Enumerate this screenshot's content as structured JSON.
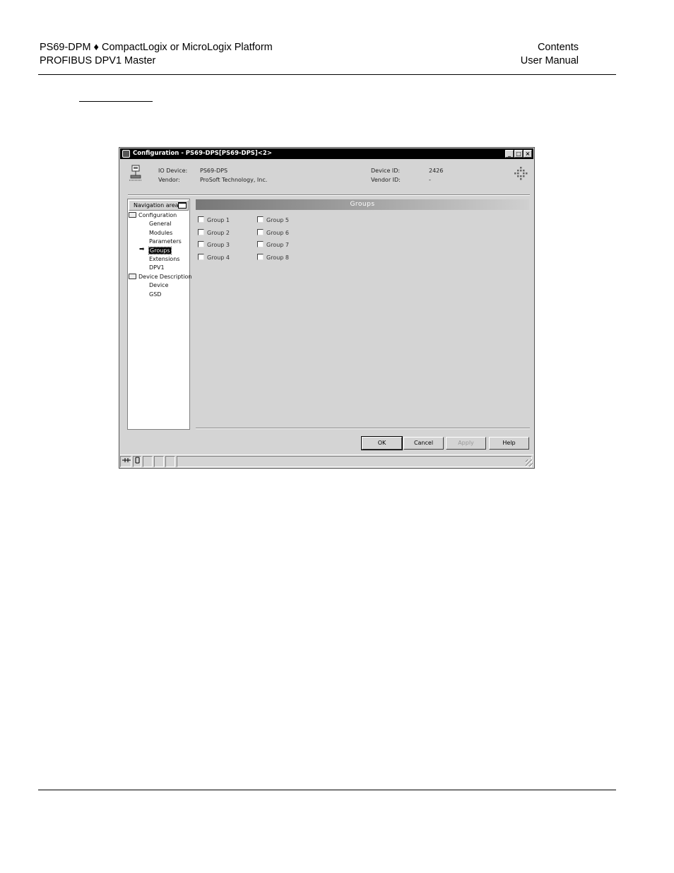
{
  "header": {
    "left_line1": "PS69-DPM ♦ CompactLogix or MicroLogix Platform",
    "left_line2": "PROFIBUS DPV1 Master",
    "right_line1": "Contents",
    "right_line2": "User Manual"
  },
  "dialog": {
    "title": "Configuration - PS69-DPS[PS69-DPS]<2>",
    "window_buttons": [
      "_",
      "□",
      "×"
    ],
    "info": {
      "io_device_label": "IO Device:",
      "io_device_value": "PS69-DPS",
      "vendor_label": "Vendor:",
      "vendor_value": "ProSoft Technology, Inc.",
      "device_id_label": "Device ID:",
      "device_id_value": "2426",
      "vendor_id_label": "Vendor ID:",
      "vendor_id_value": "-"
    },
    "nav": {
      "title": "Navigation area",
      "items": [
        {
          "label": "Configuration",
          "type": "folder"
        },
        {
          "label": "General",
          "type": "leaf"
        },
        {
          "label": "Modules",
          "type": "leaf"
        },
        {
          "label": "Parameters",
          "type": "leaf"
        },
        {
          "label": "Groups",
          "type": "leaf",
          "selected": true
        },
        {
          "label": "Extensions",
          "type": "leaf"
        },
        {
          "label": "DPV1",
          "type": "leaf"
        },
        {
          "label": "Device Description",
          "type": "folder"
        },
        {
          "label": "Device",
          "type": "leaf"
        },
        {
          "label": "GSD",
          "type": "leaf"
        }
      ]
    },
    "panel_title": "Groups",
    "groups": [
      "Group 1",
      "Group 2",
      "Group 3",
      "Group 4",
      "Group 5",
      "Group 6",
      "Group 7",
      "Group 8"
    ],
    "buttons": {
      "ok": "OK",
      "cancel": "Cancel",
      "apply": "Apply",
      "help": "Help"
    }
  }
}
